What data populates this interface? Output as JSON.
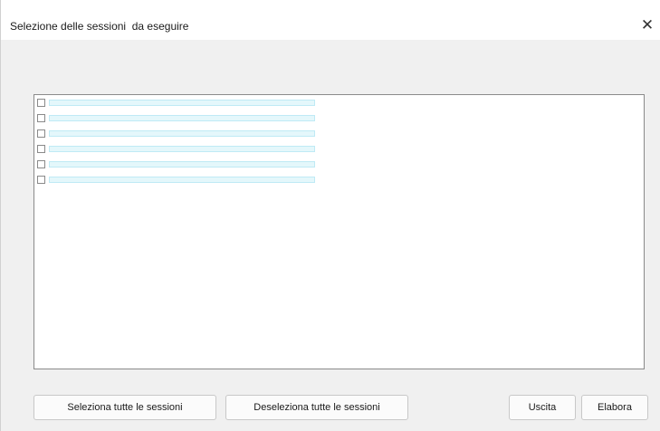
{
  "window": {
    "title": "Selezione delle sessioni  da eseguire",
    "close_glyph": "✕"
  },
  "session_list": {
    "items": [
      {
        "checked": false
      },
      {
        "checked": false
      },
      {
        "checked": false
      },
      {
        "checked": false
      },
      {
        "checked": false
      },
      {
        "checked": false
      }
    ]
  },
  "buttons": {
    "select_all": "Seleziona tutte le sessioni",
    "deselect_all": "Deseleziona tutte le sessioni",
    "exit": "Uscita",
    "process": "Elabora"
  },
  "colors": {
    "item_highlight": "#e4f7fb"
  }
}
